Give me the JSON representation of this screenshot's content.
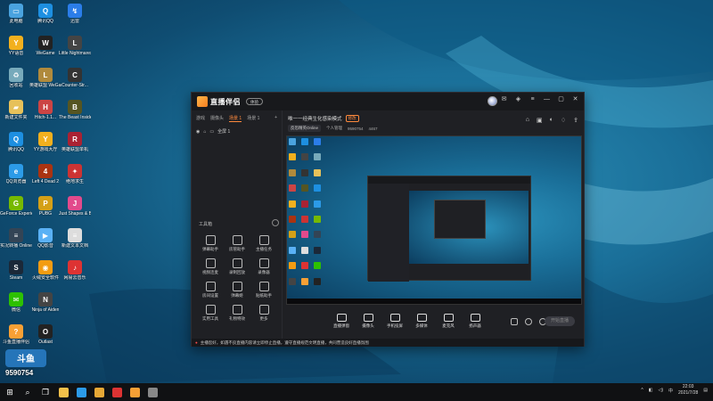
{
  "desktop": {
    "icons": [
      {
        "label": "此电脑",
        "color": "#4aa3df",
        "glyph": "▭"
      },
      {
        "label": "腾讯QQ",
        "color": "#1d8fe1",
        "glyph": "Q"
      },
      {
        "label": "迅雷",
        "color": "#2b7de9",
        "glyph": "↯"
      },
      {
        "label": "YY语音",
        "color": "#f2b01e",
        "glyph": "Y"
      },
      {
        "label": "WeGame",
        "color": "#222",
        "glyph": "W"
      },
      {
        "label": "Little Nightmares",
        "color": "#444",
        "glyph": "L"
      },
      {
        "label": "回收站",
        "color": "#7ab",
        "glyph": "♻"
      },
      {
        "label": "英雄联盟 WeGame版",
        "color": "#b08a3c",
        "glyph": "L"
      },
      {
        "label": "Counter-Str...",
        "color": "#333",
        "glyph": "C"
      },
      {
        "label": "新建文件夹",
        "color": "#e7c15a",
        "glyph": "▰"
      },
      {
        "label": "Hitch-1.1...",
        "color": "#c44",
        "glyph": "H"
      },
      {
        "label": "The Beast Inside",
        "color": "#552",
        "glyph": "B"
      },
      {
        "label": "腾讯QQ",
        "color": "#1d8fe1",
        "glyph": "Q"
      },
      {
        "label": "YY游戏大厅",
        "color": "#f2b01e",
        "glyph": "Y"
      },
      {
        "label": "英雄联盟单机",
        "color": "#a23",
        "glyph": "R"
      },
      {
        "label": "QQ浏览器",
        "color": "#2c9be8",
        "glyph": "e"
      },
      {
        "label": "Left 4 Dead 2",
        "color": "#a31",
        "glyph": "4"
      },
      {
        "label": "绝地求生",
        "color": "#c33",
        "glyph": "✦"
      },
      {
        "label": "GeForce Experience",
        "color": "#76b900",
        "glyph": "G"
      },
      {
        "label": "PUBG",
        "color": "#d4a017",
        "glyph": "P"
      },
      {
        "label": "Just Shapes & Beats",
        "color": "#e24a8c",
        "glyph": "J"
      },
      {
        "label": "实况转播 Online",
        "color": "#345",
        "glyph": "≡"
      },
      {
        "label": "QQ影音",
        "color": "#5ab1f5",
        "glyph": "▶"
      },
      {
        "label": "新建文本文档",
        "color": "#ddd",
        "glyph": "≡"
      },
      {
        "label": "Steam",
        "color": "#1b2838",
        "glyph": "S"
      },
      {
        "label": "火绒安全软件",
        "color": "#f39c12",
        "glyph": "◉"
      },
      {
        "label": "网易云音乐",
        "color": "#d33",
        "glyph": "♪"
      },
      {
        "label": "微信",
        "color": "#2dc100",
        "glyph": "✉"
      },
      {
        "label": "Ninja of Aiden",
        "color": "#444",
        "glyph": "N"
      },
      {
        "label": "",
        "color": "transparent",
        "glyph": ""
      },
      {
        "label": "斗鱼直播伴侣",
        "color": "#f7a035",
        "glyph": "?"
      },
      {
        "label": "Outlast",
        "color": "#222",
        "glyph": "O"
      }
    ]
  },
  "app": {
    "logo_text": "直播伴侣",
    "version_badge": "体验",
    "scene_tabs": [
      "游戏",
      "摄像头",
      "场景 1",
      "场景 1"
    ],
    "active_scene_index": 2,
    "source_name": "全屏 1",
    "tools_title": "工具箱",
    "tools": [
      {
        "label": "弹幕助手"
      },
      {
        "label": "房管助手"
      },
      {
        "label": "主播任务"
      },
      {
        "label": "视频连麦"
      },
      {
        "label": "录制回放"
      },
      {
        "label": "录像器"
      },
      {
        "label": "房间设置"
      },
      {
        "label": "弹幕姬"
      },
      {
        "label": "贴纸助手"
      },
      {
        "label": "实用工具"
      },
      {
        "label": "礼物特效"
      },
      {
        "label": "更多"
      }
    ],
    "room_title": "唯一一经典生化感染模式",
    "room_tag": "修改",
    "room_category": "反恐精英Online",
    "room_meta_a": "个人管理",
    "room_id": "9590754",
    "room_hot": "4467",
    "bottom_tools": [
      {
        "label": "直播弹窗"
      },
      {
        "label": "摄像头"
      },
      {
        "label": "手机投屏"
      },
      {
        "label": "多媒体"
      },
      {
        "label": "麦克风"
      },
      {
        "label": "扬声器"
      }
    ],
    "start_button": "开始直播",
    "notice": "主播您好，如遇不良直播内容请立即停止直播，遵守直播规范文明直播，共同营造良好直播氛围"
  },
  "watermark": {
    "brand": "斗鱼",
    "room_number": "9590754"
  },
  "taskbar": {
    "time": "22:03",
    "date": "2021/7/28",
    "ime": "中",
    "apps": [
      {
        "name": "file-explorer",
        "color": "#f3c04a"
      },
      {
        "name": "qq-browser",
        "color": "#2c9be8"
      },
      {
        "name": "folder",
        "color": "#e7a836"
      },
      {
        "name": "red-app",
        "color": "#d33"
      },
      {
        "name": "douyu-companion",
        "color": "#f7a035"
      },
      {
        "name": "counter-strike",
        "color": "#888"
      }
    ]
  }
}
